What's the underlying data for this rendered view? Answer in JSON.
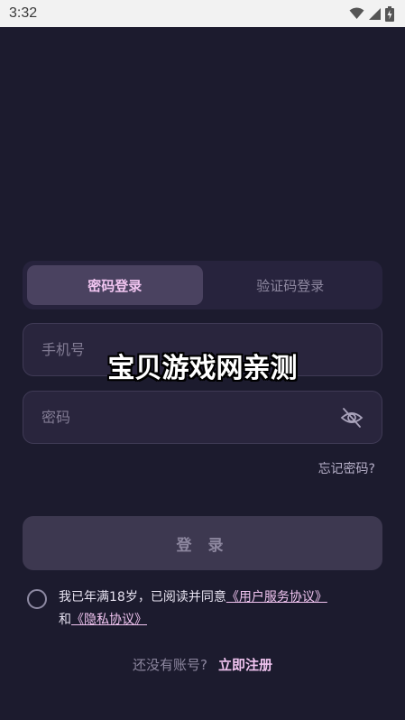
{
  "status_bar": {
    "time": "3:32"
  },
  "tabs": {
    "items": [
      {
        "label": "密码登录",
        "active": true
      },
      {
        "label": "验证码登录",
        "active": false
      }
    ]
  },
  "form": {
    "phone_placeholder": "手机号",
    "password_placeholder": "密码",
    "forgot_label": "忘记密码?",
    "login_label": "登 录"
  },
  "watermark": "宝贝游戏网亲测",
  "agreement": {
    "prefix": "我已年满18岁，已阅读并同意",
    "user_terms": "《用户服务协议》",
    "conjunction": "和",
    "privacy": "《隐私协议》"
  },
  "register": {
    "prompt": "还没有账号?",
    "link": "立即注册"
  },
  "colors": {
    "background": "#1c1b2e",
    "accent": "#f0c4f0",
    "field": "#29253d",
    "button": "#3d3850"
  }
}
